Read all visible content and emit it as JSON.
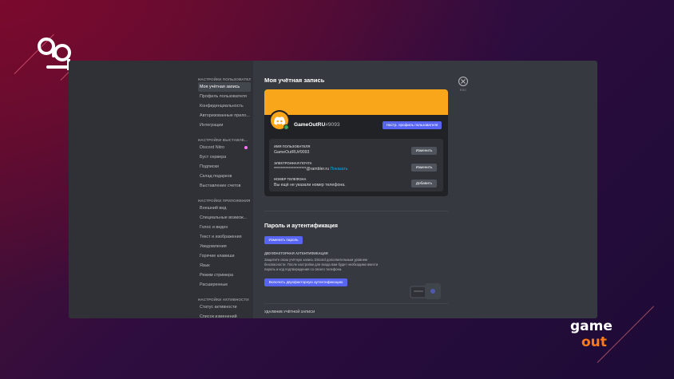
{
  "sidebar": {
    "sections": [
      {
        "title": "НАСТРОЙКИ ПОЛЬЗОВАТЕЛЯ",
        "items": [
          {
            "label": "Моя учётная запись",
            "active": true
          },
          {
            "label": "Профиль пользователя"
          },
          {
            "label": "Конфиденциальность"
          },
          {
            "label": "Авторизованные прило..."
          },
          {
            "label": "Интеграции"
          }
        ]
      },
      {
        "title": "НАСТРОЙКИ ВЫСТАВЛЕ...",
        "items": [
          {
            "label": "Discord Nitro"
          },
          {
            "label": "Буст сервера"
          },
          {
            "label": "Подписки"
          },
          {
            "label": "Склад подарков"
          },
          {
            "label": "Выставление счетов"
          }
        ]
      },
      {
        "title": "НАСТРОЙКИ ПРИЛОЖЕНИЯ",
        "items": [
          {
            "label": "Внешний вид"
          },
          {
            "label": "Специальные возмож..."
          },
          {
            "label": "Голос и видео"
          },
          {
            "label": "Текст и изображения"
          },
          {
            "label": "Уведомления"
          },
          {
            "label": "Горячие клавиши"
          },
          {
            "label": "Язык"
          },
          {
            "label": "Режим стримера"
          },
          {
            "label": "Расширенные"
          }
        ]
      },
      {
        "title": "НАСТРОЙКИ АКТИВНОСТИ",
        "items": [
          {
            "label": "Статус активности"
          },
          {
            "label": "Список изменений"
          }
        ]
      }
    ]
  },
  "account": {
    "heading": "Моя учётная запись",
    "username": "GameOutRU",
    "tag": "#9093",
    "edit_profile_label": "Настр. профиль пользователя",
    "banner_color": "#faa61a",
    "fields": [
      {
        "label": "ИМЯ ПОЛЬЗОВАТЕЛЯ",
        "value": "GameOutRU#9093",
        "link": "",
        "button": "Изменить"
      },
      {
        "label": "ЭЛЕКТРОННАЯ ПОЧТА",
        "value": "********************@rambler.ru",
        "link": "Показать",
        "button": "Изменить"
      },
      {
        "label": "НОМЕР ТЕЛЕФОНА",
        "value": "Вы ещё не указали номер телефона.",
        "link": "",
        "button": "Добавить"
      }
    ]
  },
  "security": {
    "heading": "Пароль и аутентификация",
    "change_password_label": "Изменить пароль",
    "twofa_title": "ДВУХФАКТОРНАЯ АУТЕНТИФИКАЦИЯ",
    "twofa_desc": "Защитите свою учётную запись Discord дополнительным уровнем безопасности. После настройки для входа вам будет необходимо ввести пароль и код подтверждения со своего телефона.",
    "enable_2fa_label": "Включить двухфакторную аутентификацию",
    "delete_title": "УДАЛЕНИЕ УЧЁТНОЙ ЗАПИСИ"
  },
  "close": {
    "esc_label": "ESC"
  },
  "colors": {
    "accent": "#5865f2",
    "online": "#3ba55d",
    "link": "#00aff4"
  }
}
